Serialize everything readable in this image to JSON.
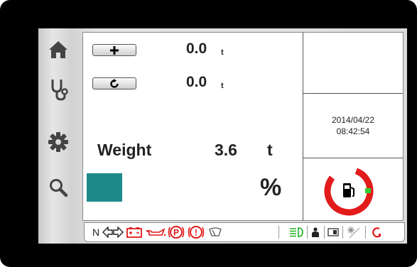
{
  "counters": [
    {
      "button_icon": "plus-icon",
      "value": "0.0",
      "unit": "t"
    },
    {
      "button_icon": "refresh-icon",
      "value": "0.0",
      "unit": "t"
    }
  ],
  "weight": {
    "label": "Weight",
    "value": "3.6",
    "unit": "t"
  },
  "percent": {
    "symbol": "%",
    "swatch_color": "#1f8a8a"
  },
  "datetime": {
    "date": "2014/04/22",
    "time": "08:42:54"
  },
  "fuel": {
    "icon": "fuel-pump-icon",
    "arc_color": "#e21b1b",
    "low_color": "#2fcf2f"
  },
  "sidebar": [
    {
      "icon": "home-icon"
    },
    {
      "icon": "stethoscope-icon"
    },
    {
      "icon": "gear-icon"
    },
    {
      "icon": "search-icon"
    }
  ],
  "status_bar": {
    "neutral": "N",
    "colors": {
      "red": "#e01919",
      "green": "#22b022",
      "dark": "#333333"
    },
    "icons": [
      "turn-signals-icon",
      "battery-warning-icon",
      "oil-pressure-icon",
      "parking-brake-icon",
      "general-warning-icon",
      "wiper-icon",
      "headlight-icon",
      "seat-occupancy-icon",
      "rear-lights-icon",
      "day-night-icon",
      "power-icon"
    ],
    "parking_label": "P",
    "warning_label": "!"
  }
}
